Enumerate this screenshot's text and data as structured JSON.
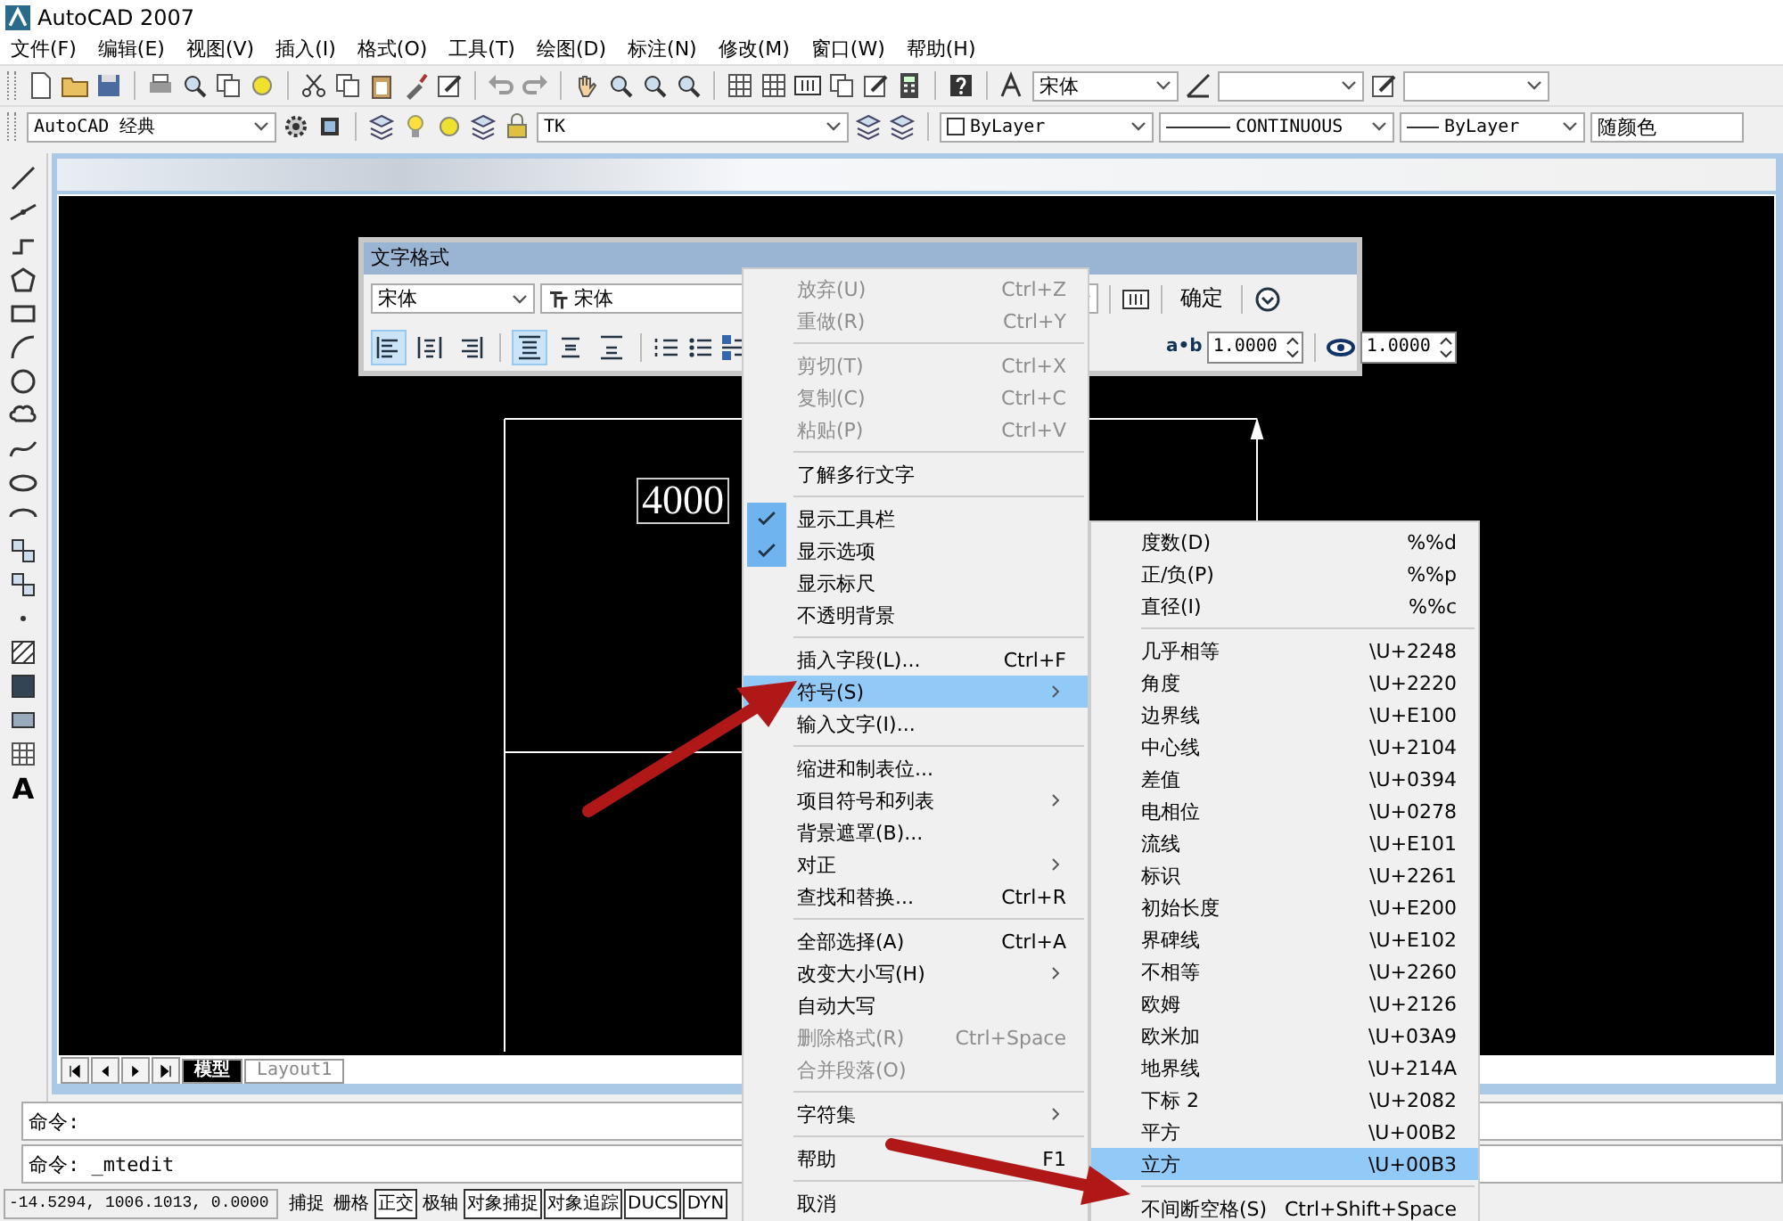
{
  "window": {
    "title": "AutoCAD 2007"
  },
  "menu_bar": [
    "文件(F)",
    "编辑(E)",
    "视图(V)",
    "插入(I)",
    "格式(O)",
    "工具(T)",
    "绘图(D)",
    "标注(N)",
    "修改(M)",
    "窗口(W)",
    "帮助(H)"
  ],
  "standard_toolbar": {
    "text_style": "宋体"
  },
  "layers_toolbar": {
    "workspace": "AutoCAD 经典",
    "layer": "TK",
    "color_control": "ByLayer",
    "linetype": "CONTINUOUS",
    "lineweight": "ByLayer",
    "plot_style": "随颜色"
  },
  "left_toolbar": {
    "text_tool": "A"
  },
  "drawing": {
    "dimension_text": "4000"
  },
  "text_formatting": {
    "title": "文字格式",
    "style": "宋体",
    "font": "宋体",
    "ok_button": "确定",
    "alignment": [
      {
        "selected": true
      },
      {
        "selected": false
      },
      {
        "selected": false
      }
    ],
    "vertical_alignment": [
      {
        "selected": true
      },
      {
        "selected": false
      },
      {
        "selected": false
      }
    ],
    "tracking_glyph": "a•b",
    "tracking": "1.0000",
    "width_factor": "1.0000"
  },
  "context_menu": [
    {
      "kind": "item",
      "label": "放弃(U)",
      "shortcut": "Ctrl+Z",
      "disabled": true,
      "checked": false,
      "submenu": false,
      "selected": false
    },
    {
      "kind": "item",
      "label": "重做(R)",
      "shortcut": "Ctrl+Y",
      "disabled": true,
      "checked": false,
      "submenu": false,
      "selected": false
    },
    {
      "kind": "separator"
    },
    {
      "kind": "item",
      "label": "剪切(T)",
      "shortcut": "Ctrl+X",
      "disabled": true,
      "checked": false,
      "submenu": false,
      "selected": false
    },
    {
      "kind": "item",
      "label": "复制(C)",
      "shortcut": "Ctrl+C",
      "disabled": true,
      "checked": false,
      "submenu": false,
      "selected": false
    },
    {
      "kind": "item",
      "label": "粘贴(P)",
      "shortcut": "Ctrl+V",
      "disabled": true,
      "checked": false,
      "submenu": false,
      "selected": false
    },
    {
      "kind": "separator"
    },
    {
      "kind": "item",
      "label": "了解多行文字",
      "disabled": false,
      "checked": false,
      "submenu": false,
      "selected": false
    },
    {
      "kind": "separator"
    },
    {
      "kind": "item",
      "label": "显示工具栏",
      "disabled": false,
      "checked": true,
      "submenu": false,
      "selected": false
    },
    {
      "kind": "item",
      "label": "显示选项",
      "disabled": false,
      "checked": true,
      "submenu": false,
      "selected": false
    },
    {
      "kind": "item",
      "label": "显示标尺",
      "disabled": false,
      "checked": false,
      "submenu": false,
      "selected": false
    },
    {
      "kind": "item",
      "label": "不透明背景",
      "disabled": false,
      "checked": false,
      "submenu": false,
      "selected": false
    },
    {
      "kind": "separator"
    },
    {
      "kind": "item",
      "label": "插入字段(L)...",
      "shortcut": "Ctrl+F",
      "disabled": false,
      "checked": false,
      "submenu": false,
      "selected": false
    },
    {
      "kind": "item",
      "label": "符号(S)",
      "disabled": false,
      "checked": false,
      "submenu": true,
      "selected": true
    },
    {
      "kind": "item",
      "label": "输入文字(I)...",
      "disabled": false,
      "checked": false,
      "submenu": false,
      "selected": false
    },
    {
      "kind": "separator"
    },
    {
      "kind": "item",
      "label": "缩进和制表位...",
      "disabled": false,
      "checked": false,
      "submenu": false,
      "selected": false
    },
    {
      "kind": "item",
      "label": "项目符号和列表",
      "disabled": false,
      "checked": false,
      "submenu": true,
      "selected": false
    },
    {
      "kind": "item",
      "label": "背景遮罩(B)...",
      "disabled": false,
      "checked": false,
      "submenu": false,
      "selected": false
    },
    {
      "kind": "item",
      "label": "对正",
      "disabled": false,
      "checked": false,
      "submenu": true,
      "selected": false
    },
    {
      "kind": "item",
      "label": "查找和替换...",
      "shortcut": "Ctrl+R",
      "disabled": false,
      "checked": false,
      "submenu": false,
      "selected": false
    },
    {
      "kind": "separator"
    },
    {
      "kind": "item",
      "label": "全部选择(A)",
      "shortcut": "Ctrl+A",
      "disabled": false,
      "checked": false,
      "submenu": false,
      "selected": false
    },
    {
      "kind": "item",
      "label": "改变大小写(H)",
      "disabled": false,
      "checked": false,
      "submenu": true,
      "selected": false
    },
    {
      "kind": "item",
      "label": "自动大写",
      "disabled": false,
      "checked": false,
      "submenu": false,
      "selected": false
    },
    {
      "kind": "item",
      "label": "删除格式(R)",
      "shortcut": "Ctrl+Space",
      "disabled": true,
      "checked": false,
      "submenu": false,
      "selected": false
    },
    {
      "kind": "item",
      "label": "合并段落(O)",
      "disabled": true,
      "checked": false,
      "submenu": false,
      "selected": false
    },
    {
      "kind": "separator"
    },
    {
      "kind": "item",
      "label": "字符集",
      "disabled": false,
      "checked": false,
      "submenu": true,
      "selected": false
    },
    {
      "kind": "separator"
    },
    {
      "kind": "item",
      "label": "帮助",
      "shortcut": "F1",
      "disabled": false,
      "checked": false,
      "submenu": false,
      "selected": false
    },
    {
      "kind": "separator"
    },
    {
      "kind": "item",
      "label": "取消",
      "disabled": false,
      "checked": false,
      "submenu": false,
      "selected": false
    }
  ],
  "symbol_submenu": [
    {
      "kind": "item",
      "label": "度数(D)",
      "shortcut": "%%d",
      "selected": false
    },
    {
      "kind": "item",
      "label": "正/负(P)",
      "shortcut": "%%p",
      "selected": false
    },
    {
      "kind": "item",
      "label": "直径(I)",
      "shortcut": "%%c",
      "selected": false
    },
    {
      "kind": "separator"
    },
    {
      "kind": "item",
      "label": "几乎相等",
      "shortcut": "\\U+2248",
      "selected": false
    },
    {
      "kind": "item",
      "label": "角度",
      "shortcut": "\\U+2220",
      "selected": false
    },
    {
      "kind": "item",
      "label": "边界线",
      "shortcut": "\\U+E100",
      "selected": false
    },
    {
      "kind": "item",
      "label": "中心线",
      "shortcut": "\\U+2104",
      "selected": false
    },
    {
      "kind": "item",
      "label": "差值",
      "shortcut": "\\U+0394",
      "selected": false
    },
    {
      "kind": "item",
      "label": "电相位",
      "shortcut": "\\U+0278",
      "selected": false
    },
    {
      "kind": "item",
      "label": "流线",
      "shortcut": "\\U+E101",
      "selected": false
    },
    {
      "kind": "item",
      "label": "标识",
      "shortcut": "\\U+2261",
      "selected": false
    },
    {
      "kind": "item",
      "label": "初始长度",
      "shortcut": "\\U+E200",
      "selected": false
    },
    {
      "kind": "item",
      "label": "界碑线",
      "shortcut": "\\U+E102",
      "selected": false
    },
    {
      "kind": "item",
      "label": "不相等",
      "shortcut": "\\U+2260",
      "selected": false
    },
    {
      "kind": "item",
      "label": "欧姆",
      "shortcut": "\\U+2126",
      "selected": false
    },
    {
      "kind": "item",
      "label": "欧米加",
      "shortcut": "\\U+03A9",
      "selected": false
    },
    {
      "kind": "item",
      "label": "地界线",
      "shortcut": "\\U+214A",
      "selected": false
    },
    {
      "kind": "item",
      "label": "下标 2",
      "shortcut": "\\U+2082",
      "selected": false
    },
    {
      "kind": "item",
      "label": "平方",
      "shortcut": "\\U+00B2",
      "selected": false
    },
    {
      "kind": "item",
      "label": "立方",
      "shortcut": "\\U+00B3",
      "selected": true
    },
    {
      "kind": "separator"
    },
    {
      "kind": "item",
      "label": "不间断空格(S)",
      "shortcut": "Ctrl+Shift+Space",
      "selected": false
    }
  ],
  "layout_tabs": [
    {
      "label": "模型",
      "selected": true
    },
    {
      "label": "Layout1",
      "selected": false
    }
  ],
  "command_lines": [
    "命令:",
    "命令: _mtedit"
  ],
  "status_bar": {
    "coordinates": "-14.5294, 1006.1013, 0.0000",
    "buttons": [
      {
        "label": "捕捉",
        "on": false
      },
      {
        "label": "栅格",
        "on": false
      },
      {
        "label": "正交",
        "on": true
      },
      {
        "label": "极轴",
        "on": false
      },
      {
        "label": "对象捕捉",
        "on": true
      },
      {
        "label": "对象追踪",
        "on": true
      },
      {
        "label": "DUCS",
        "on": true
      },
      {
        "label": "DYN",
        "on": true
      }
    ]
  }
}
